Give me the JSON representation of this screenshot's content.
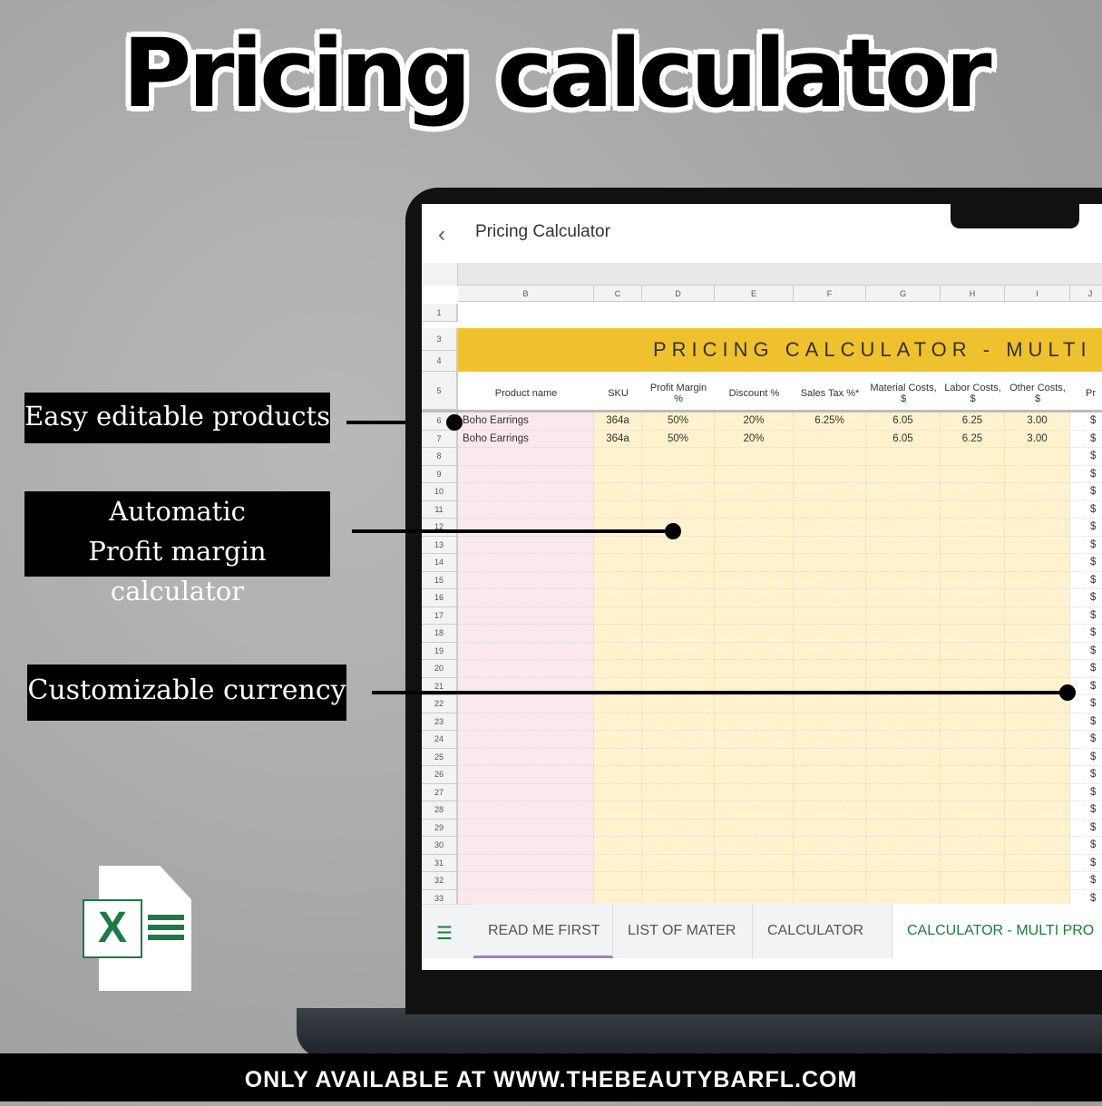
{
  "headline": "Pricing calculator",
  "callouts": [
    "Easy editable products",
    "Automatic",
    "Profit margin calculator",
    "Customizable currency"
  ],
  "footer": "ONLY AVAILABLE AT WWW.THEBEAUTYBARFL.COM",
  "app": {
    "title": "Pricing Calculator",
    "back_icon": "chevron-left-icon"
  },
  "columns": [
    "B",
    "C",
    "D",
    "E",
    "F",
    "G",
    "H",
    "I",
    "J"
  ],
  "banner": "PRICING CALCULATOR - MULTI",
  "headers": [
    "Product name",
    "SKU",
    "Profit Margin %",
    "Discount %",
    "Sales Tax %*",
    "Material Costs, $",
    "Labor Costs, $",
    "Other Costs, $",
    "Pr"
  ],
  "rows": [
    {
      "n": "6",
      "cells": [
        "Boho Earrings",
        "364a",
        "50%",
        "20%",
        "6.25%",
        "6.05",
        "6.25",
        "3.00"
      ]
    },
    {
      "n": "7",
      "cells": [
        "Boho Earrings",
        "364a",
        "50%",
        "20%",
        "",
        "6.05",
        "6.25",
        "3.00"
      ]
    }
  ],
  "empty_rows": [
    "8",
    "9",
    "10",
    "11",
    "12",
    "13",
    "14",
    "15",
    "16",
    "17",
    "18",
    "19",
    "20",
    "21",
    "22",
    "23",
    "24",
    "25",
    "26",
    "27",
    "28",
    "29",
    "30",
    "31",
    "32",
    "33"
  ],
  "top_rows": [
    "1",
    "3",
    "4",
    "5"
  ],
  "currency_symbol": "$",
  "tabs": [
    "READ ME FIRST",
    "LIST OF MATER",
    "CALCULATOR",
    "CALCULATOR - MULTI PRO"
  ],
  "colors": {
    "banner": "#f0c12e",
    "product_col": "#f9e8ec",
    "input_cols": "#fff2cc",
    "active_tab": "#188038",
    "tab_underline": "#9b7fd0"
  }
}
